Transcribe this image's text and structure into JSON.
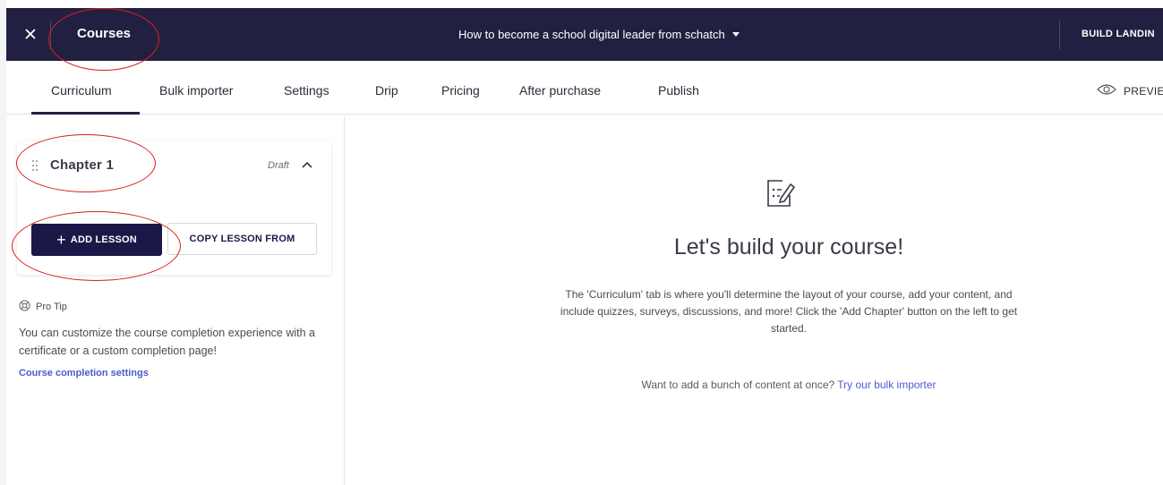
{
  "topbar": {
    "title": "Courses",
    "course_name": "How to become a school digital leader from schatch",
    "build_button": "BUILD LANDIN",
    "close_icon": "close-icon",
    "colors": {
      "background": "#222041",
      "text": "#ffffff"
    }
  },
  "tabs": {
    "items": [
      {
        "label": "Curriculum",
        "active": true
      },
      {
        "label": "Bulk importer"
      },
      {
        "label": "Settings"
      },
      {
        "label": "Drip"
      },
      {
        "label": "Pricing"
      },
      {
        "label": "After purchase"
      },
      {
        "label": "Publish"
      }
    ],
    "preview_label": "PREVIE",
    "preview_icon": "eye-icon"
  },
  "chapter": {
    "title": "Chapter 1",
    "status": "Draft",
    "add_lesson_label": "ADD LESSON",
    "copy_lesson_label": "COPY LESSON FROM"
  },
  "protip": {
    "label": "Pro Tip",
    "text": "You can customize the course completion experience with a certificate or a custom completion page!",
    "link": "Course completion settings",
    "icon": "lifebuoy-icon"
  },
  "main": {
    "icon": "edit-note-icon",
    "heading": "Let's build your course!",
    "description": "The 'Curriculum' tab is where you'll determine the layout of your course, add your content, and include quizzes, surveys, discussions, and more! Click the 'Add Chapter' button on the left to get started.",
    "bulk_prompt": "Want to add a bunch of content at once?",
    "bulk_link": "Try our bulk importer"
  },
  "colors": {
    "primary": "#1b1848",
    "link": "#4b5bd0",
    "annotation": "#d81e1e"
  }
}
